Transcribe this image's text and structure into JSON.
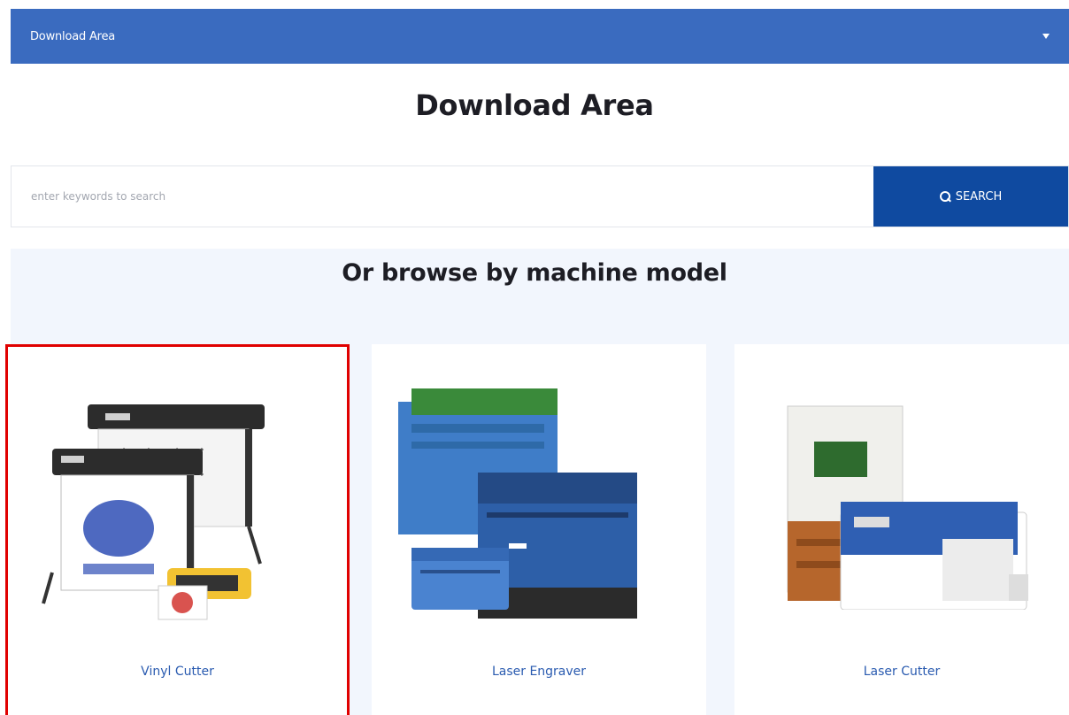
{
  "header": {
    "dropdown_label": "Download Area"
  },
  "page_title": "Download Area",
  "search": {
    "placeholder": "enter keywords to search",
    "button_label": "SEARCH"
  },
  "browse": {
    "title": "Or browse by machine model",
    "cards": [
      {
        "label": "Vinyl Cutter",
        "selected": true
      },
      {
        "label": "Laser Engraver",
        "selected": false
      },
      {
        "label": "Laser Cutter",
        "selected": false
      }
    ]
  },
  "colors": {
    "header_bar": "#3a6bbf",
    "search_button": "#0f4aa0",
    "card_label": "#2a5bb0",
    "selection_outline": "#e00000",
    "section_background": "#f2f6fd"
  }
}
